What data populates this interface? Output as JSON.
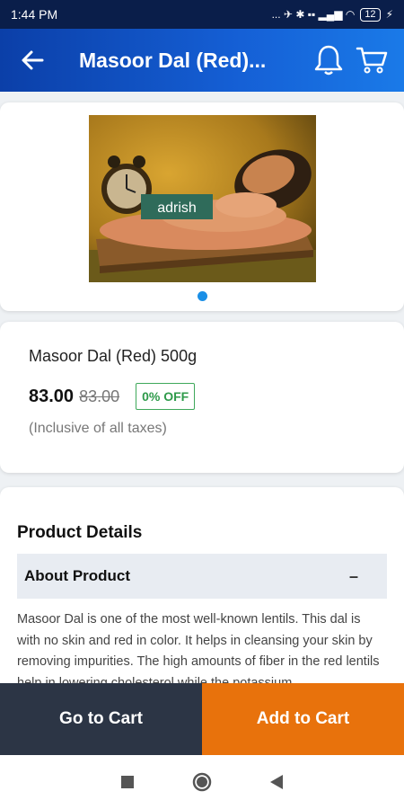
{
  "status_bar": {
    "time": "1:44 PM",
    "indicators": "... ✈ ✱ ▪▪ ▂▄▆ ◠",
    "battery": "12"
  },
  "app_bar": {
    "title": "Masoor Dal (Red)...",
    "back_icon": "back-arrow-icon",
    "notification_icon": "bell-icon",
    "cart_icon": "cart-icon"
  },
  "product_image": {
    "brand_label": "adrish",
    "carousel_index": 1,
    "carousel_count": 1
  },
  "product": {
    "name": "Masoor Dal (Red) 500g",
    "price": "83.00",
    "mrp": "83.00",
    "discount": "0% OFF",
    "tax_note": "(Inclusive of all taxes)"
  },
  "details": {
    "title": "Product Details",
    "section_label": "About Product",
    "collapse_symbol": "–",
    "description": "Masoor Dal is one of the most well-known lentils. This dal is with no skin and red in color. It helps in cleansing your skin by removing impurities. The high amounts of fiber in the red lentils help in lowering cholesterol while the potassium"
  },
  "actions": {
    "go_to_cart": "Go to Cart",
    "add_to_cart": "Add to Cart"
  },
  "colors": {
    "app_bar": "#1560d6",
    "status_bar": "#0a1e4a",
    "go_to_cart_bg": "#2c3545",
    "add_to_cart_bg": "#e8720c",
    "discount": "#2e9a4a"
  }
}
